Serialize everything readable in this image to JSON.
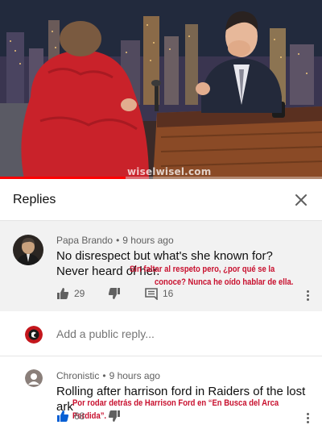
{
  "video": {
    "watermark": "wiselwisel.com",
    "progress": 0.39
  },
  "replies_header": {
    "title": "Replies",
    "close_icon": "close-icon"
  },
  "main_comment": {
    "author": "Papa Brando",
    "time": "9 hours ago",
    "text": "No disrespect but what's she known for? Never heard of her.",
    "translation_line1": "Sin faltar al respeto pero, ¿por qué se la",
    "translation_line2": "conoce? Nunca he oído hablar de ella.",
    "likes": "29",
    "replies_count": "16",
    "icons": [
      "thumbs-up-icon",
      "thumbs-down-icon",
      "reply-icon",
      "more-vert-icon"
    ]
  },
  "add_reply": {
    "placeholder": "Add a public reply..."
  },
  "reply_comment": {
    "author": "Chronistic",
    "time": "9 hours ago",
    "text": "Rolling after harrison ford in Raiders of the lost ark",
    "translation": "Por rodar detrás de Harrison Ford en “En Busca del Arca Perdida”.",
    "likes": "68",
    "icons": [
      "thumbs-up-filled-icon",
      "thumbs-down-icon",
      "more-vert-icon"
    ]
  },
  "colors": {
    "accent_blue": "#065fd4",
    "progress_red": "#ff0000",
    "translation_red": "#c8102e",
    "comment_highlight": "#f2f2f2"
  }
}
